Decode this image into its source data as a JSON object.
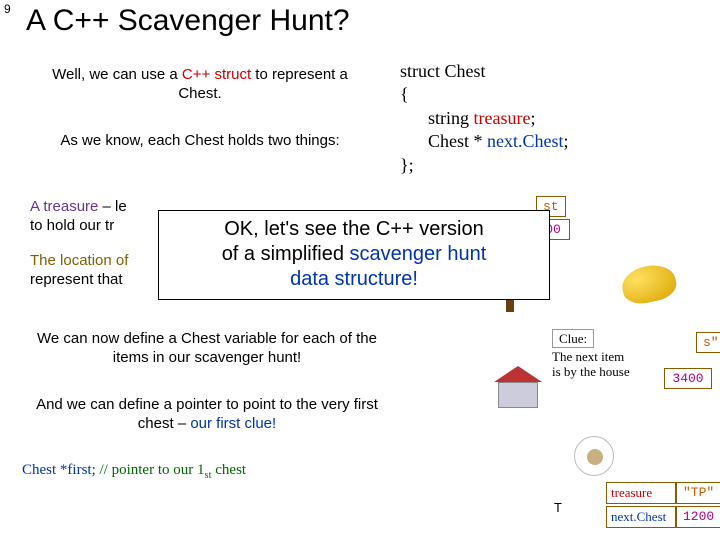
{
  "slide_number": "9",
  "title": "A C++ Scavenger Hunt?",
  "para": {
    "intro_a": "Well, we can use a ",
    "intro_b": "C++ struct",
    "intro_c": " to represent a Chest.",
    "know": "As we know, each Chest holds two things:",
    "treasure_a": "A treasure",
    "treasure_b": " – le",
    "treasure_c": "to hold our tr",
    "loc_a": "The location of",
    "loc_b": "represent that",
    "define": "We can now define a Chest variable for each of the items in our scavenger hunt!",
    "ptr_a": "And we can define a pointer to point to the very first chest – ",
    "ptr_b": "our first clue!",
    "first_a": "Chest *first;",
    "first_b": " // pointer to our 1",
    "first_c": "st",
    "first_d": " chest"
  },
  "struct": {
    "l1": "struct Chest",
    "l2": "{",
    "l3a": "string ",
    "l3b": "treasure",
    "l3c": ";",
    "l4a": "Chest * ",
    "l4b": "next.Chest",
    "l4c": ";",
    "l5": "};"
  },
  "callout": {
    "l1": "OK, let's see the C++ version",
    "l2a": "of a simplified ",
    "l2b": "scavenger hunt",
    "l3": "data structure!"
  },
  "scene": {
    "st": "st",
    "clue": "Clue:",
    "fragment_s": "s\"",
    "next_line1": "The next item",
    "next_line2": "is by the house",
    "v_3400": "3400",
    "v_00": "00",
    "lbl_treasure": "treasure",
    "lbl_nextchest": "next.Chest",
    "v_tp": "\"TP\"",
    "v_1200": "1200"
  }
}
